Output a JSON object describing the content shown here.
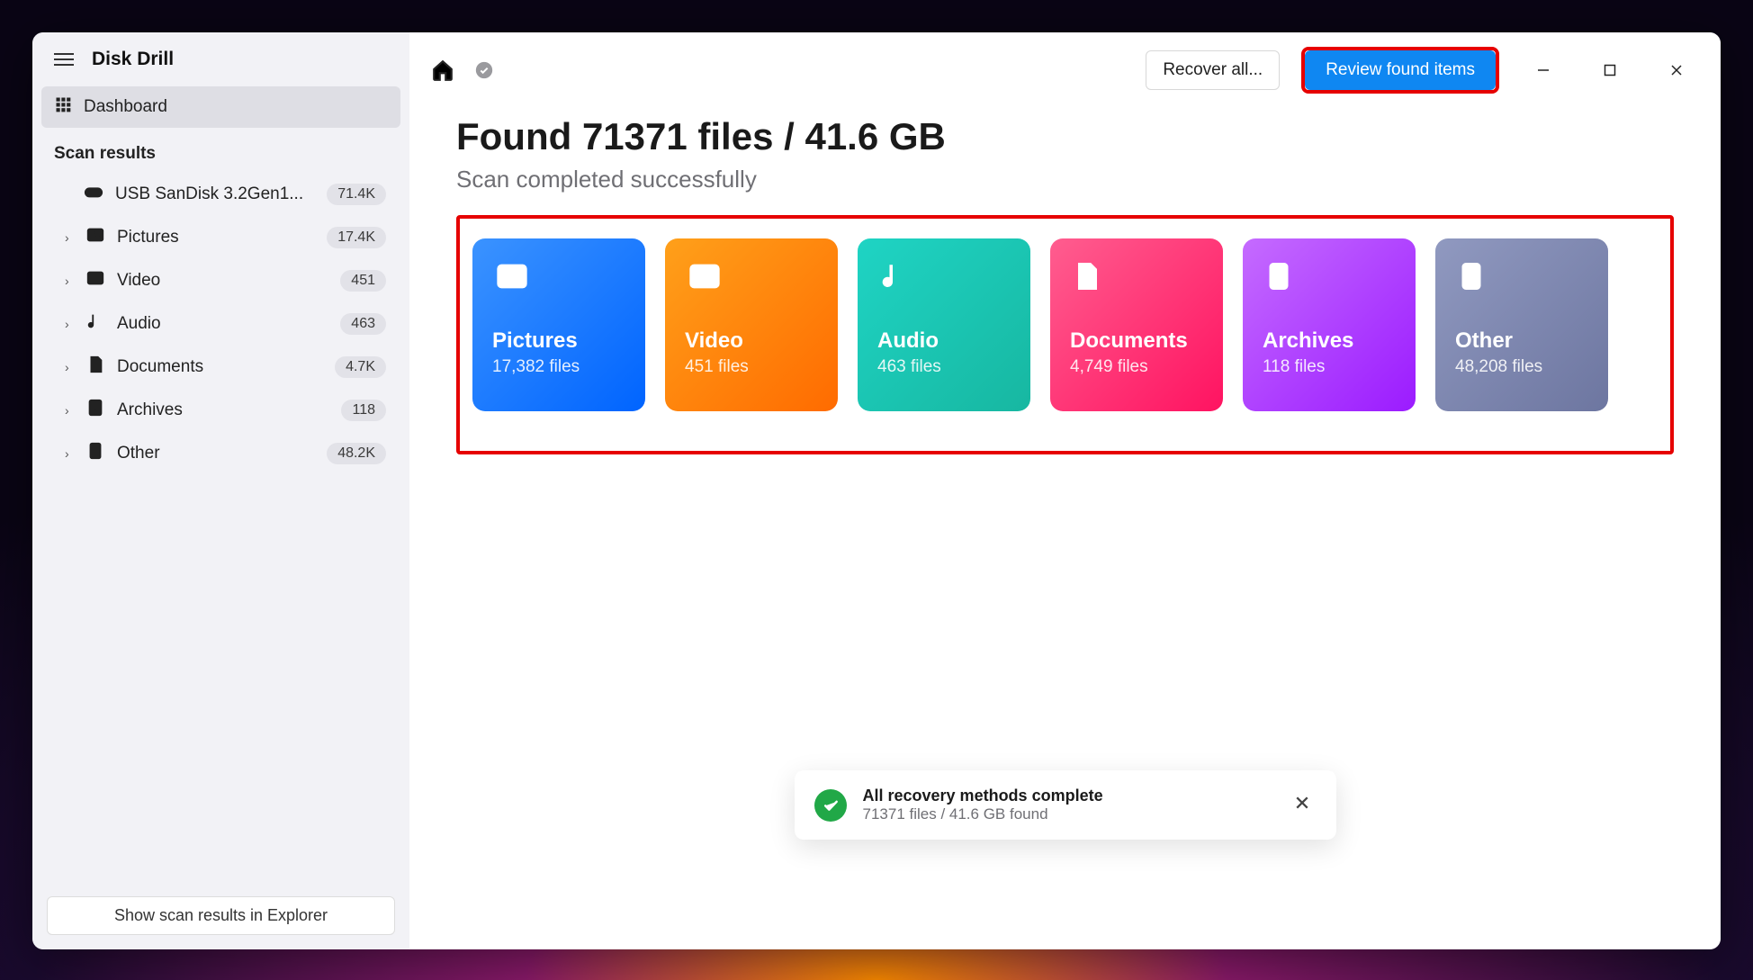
{
  "sidebar": {
    "app_title": "Disk Drill",
    "dashboard_label": "Dashboard",
    "scan_results_header": "Scan results",
    "usb": {
      "label": "USB  SanDisk 3.2Gen1...",
      "count": "71.4K"
    },
    "items": [
      {
        "label": "Pictures",
        "count": "17.4K"
      },
      {
        "label": "Video",
        "count": "451"
      },
      {
        "label": "Audio",
        "count": "463"
      },
      {
        "label": "Documents",
        "count": "4.7K"
      },
      {
        "label": "Archives",
        "count": "118"
      },
      {
        "label": "Other",
        "count": "48.2K"
      }
    ],
    "footer_button": "Show scan results in Explorer"
  },
  "topbar": {
    "recover_all_label": "Recover all...",
    "review_label": "Review found items"
  },
  "main": {
    "heading": "Found 71371 files / 41.6 GB",
    "subheading": "Scan completed successfully"
  },
  "cards": {
    "pictures": {
      "title": "Pictures",
      "sub": "17,382 files"
    },
    "video": {
      "title": "Video",
      "sub": "451 files"
    },
    "audio": {
      "title": "Audio",
      "sub": "463 files"
    },
    "documents": {
      "title": "Documents",
      "sub": "4,749 files"
    },
    "archives": {
      "title": "Archives",
      "sub": "118 files"
    },
    "other": {
      "title": "Other",
      "sub": "48,208 files"
    }
  },
  "toast": {
    "title": "All recovery methods complete",
    "sub": "71371 files / 41.6 GB found"
  }
}
